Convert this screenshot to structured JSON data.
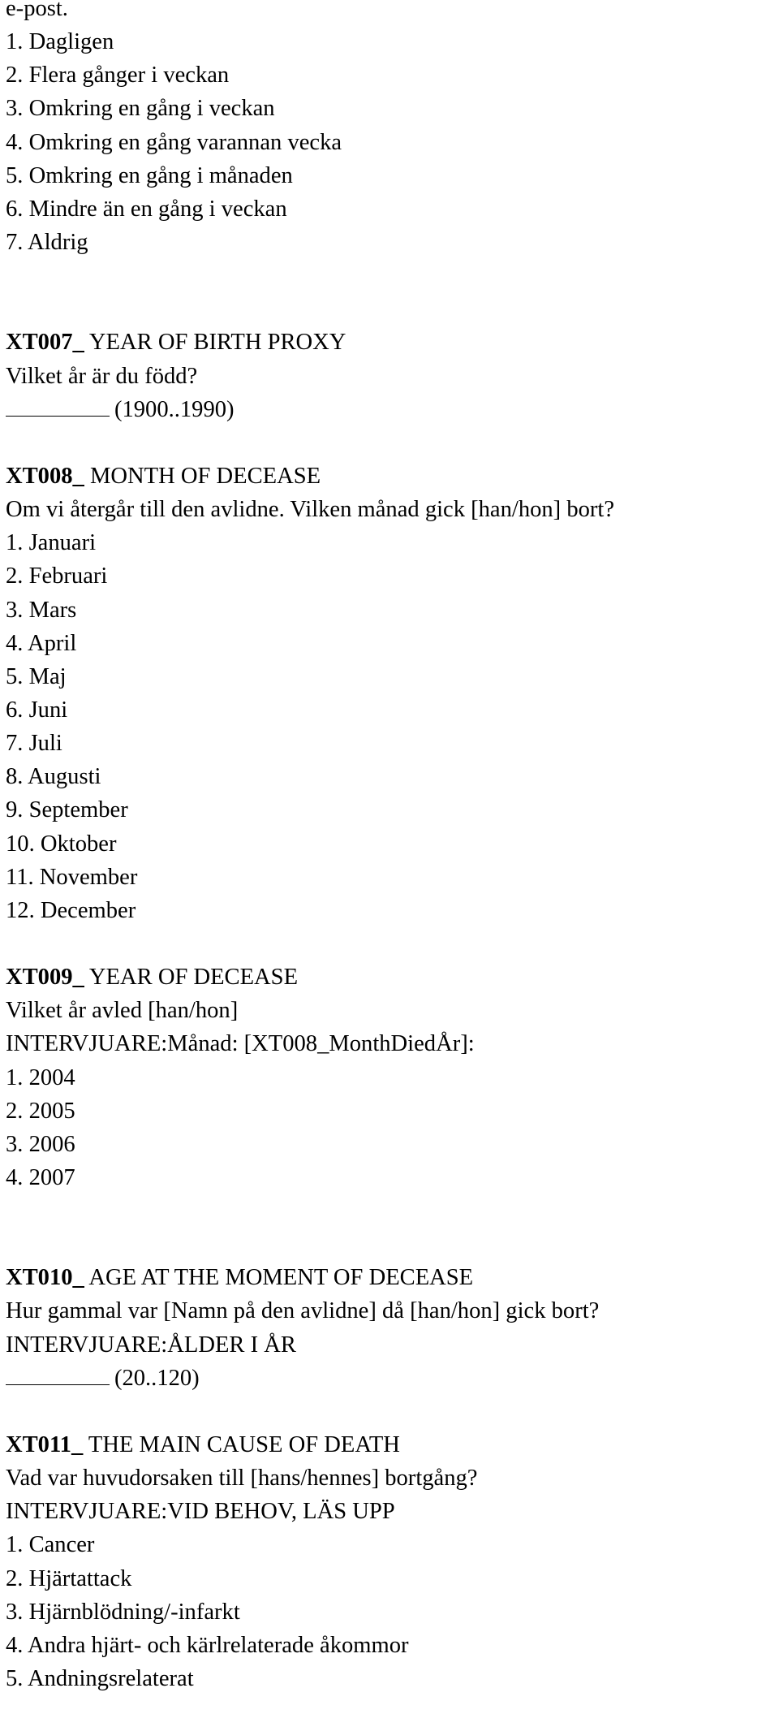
{
  "intro": {
    "tail": "e-post.",
    "options": [
      "1. Dagligen",
      "2. Flera gånger i veckan",
      "3. Omkring en gång i veckan",
      "4. Omkring en gång varannan vecka",
      "5. Omkring en gång i månaden",
      "6. Mindre än en gång i veckan",
      "7. Aldrig"
    ]
  },
  "xt007": {
    "code": "XT007_",
    "title": "YEAR OF BIRTH PROXY",
    "question": "Vilket år är du född?",
    "range": "(1900..1990)"
  },
  "xt008": {
    "code": "XT008_",
    "title": "MONTH OF DECEASE",
    "question": "Om vi återgår till den avlidne. Vilken månad gick [han/hon] bort?",
    "options": [
      "1. Januari",
      "2. Februari",
      "3. Mars",
      "4. April",
      "5. Maj",
      "6. Juni",
      "7. Juli",
      "8. Augusti",
      "9. September",
      "10. Oktober",
      "11. November",
      "12. December"
    ]
  },
  "xt009": {
    "code": "XT009_",
    "title": "YEAR OF DECEASE",
    "question": "Vilket år avled [han/hon]",
    "instruction": "INTERVJUARE:Månad: [XT008_MonthDiedÅr]:",
    "options": [
      "1. 2004",
      "2. 2005",
      "3. 2006",
      "4. 2007"
    ]
  },
  "xt010": {
    "code": "XT010_",
    "title": "AGE AT THE MOMENT OF DECEASE",
    "question": "Hur gammal var [Namn på den avlidne] då [han/hon] gick bort?",
    "instruction": "INTERVJUARE:ÅLDER I ÅR",
    "range": "(20..120)"
  },
  "xt011": {
    "code": "XT011_",
    "title": "THE MAIN CAUSE OF DEATH",
    "question": "Vad var huvudorsaken till [hans/hennes] bortgång?",
    "instruction": "INTERVJUARE:VID BEHOV, LÄS UPP",
    "options": [
      "1. Cancer",
      "2. Hjärtattack",
      "3. Hjärnblödning/-infarkt",
      "4. Andra hjärt- och kärlrelaterade åkommor",
      "5. Andningsrelaterat"
    ]
  }
}
